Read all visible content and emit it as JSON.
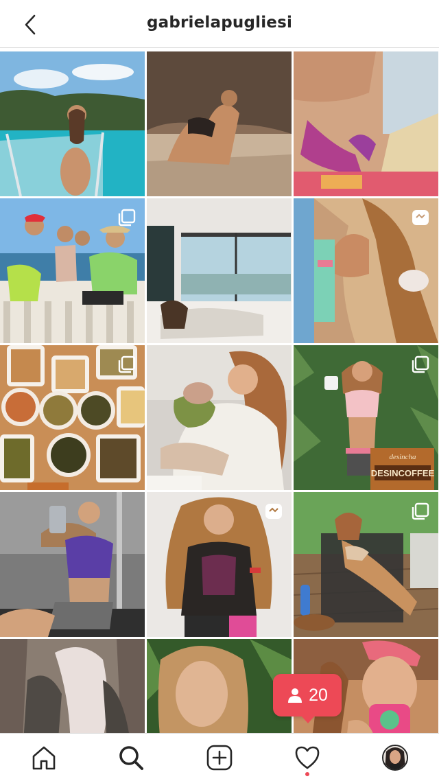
{
  "header": {
    "username": "gabrielapugliesi",
    "back_icon": "chevron-left-icon"
  },
  "grid": {
    "posts": [
      {
        "scene": "boat-sea",
        "badge": "none"
      },
      {
        "scene": "beach-rock",
        "badge": "none"
      },
      {
        "scene": "beach-selfie",
        "badge": "none"
      },
      {
        "scene": "boat-friends",
        "badge": "carousel"
      },
      {
        "scene": "bedroom-window",
        "badge": "none"
      },
      {
        "scene": "bracelets-snack",
        "badge": "reel"
      },
      {
        "scene": "food-table",
        "badge": "carousel"
      },
      {
        "scene": "baby-hug",
        "badge": "none"
      },
      {
        "scene": "gym-coffee",
        "badge": "carousel"
      },
      {
        "scene": "gym-mirror",
        "badge": "none"
      },
      {
        "scene": "hair-portrait",
        "badge": "reel"
      },
      {
        "scene": "pool-lounger",
        "badge": "carousel"
      },
      {
        "scene": "blonde-jacket",
        "badge": "none"
      },
      {
        "scene": "plants-portrait",
        "badge": "none"
      },
      {
        "scene": "cup-selfie",
        "badge": "none"
      }
    ],
    "coffee_label": "DESINCOFFEE",
    "coffee_brand": "desincha"
  },
  "activity": {
    "count": "20",
    "icon": "person-icon"
  },
  "nav": {
    "items": [
      "home-icon",
      "search-icon",
      "add-icon",
      "heart-icon",
      "profile-avatar"
    ],
    "notification_color": "#ed4956"
  }
}
